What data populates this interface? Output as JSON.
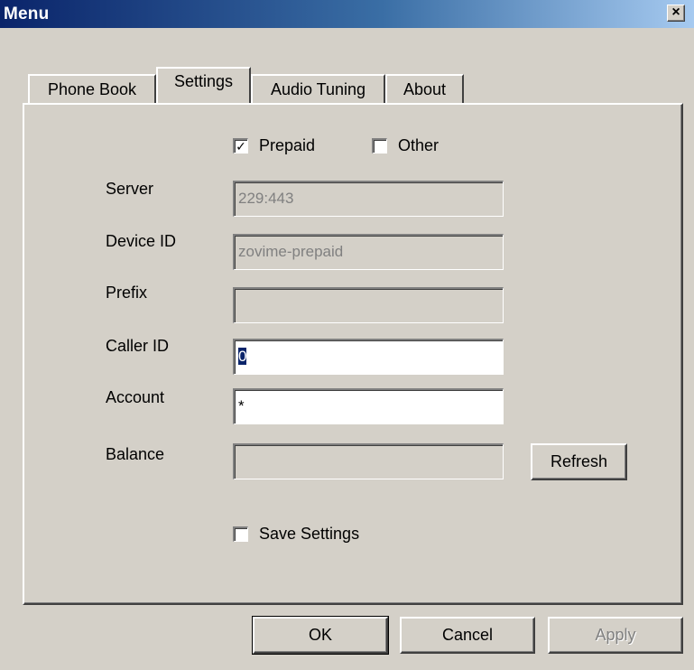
{
  "window": {
    "title": "Menu",
    "close_symbol": "×"
  },
  "tabs": [
    {
      "label": "Phone Book",
      "active": false
    },
    {
      "label": "Settings",
      "active": true
    },
    {
      "label": "Audio Tuning",
      "active": false
    },
    {
      "label": "About",
      "active": false
    }
  ],
  "settings": {
    "prepaid": {
      "label": "Prepaid",
      "checked": true,
      "mark": "✓"
    },
    "other": {
      "label": "Other",
      "checked": false
    },
    "fields": {
      "server": {
        "label": "Server",
        "value": "229:443",
        "enabled": false
      },
      "device_id": {
        "label": "Device ID",
        "value": "zovime-prepaid",
        "enabled": false
      },
      "prefix": {
        "label": "Prefix",
        "value": "",
        "enabled": false
      },
      "caller_id": {
        "label": "Caller ID",
        "value": "0",
        "enabled": true
      },
      "account": {
        "label": "Account",
        "value": "*",
        "enabled": true
      },
      "balance": {
        "label": "Balance",
        "value": "",
        "enabled": false
      }
    },
    "refresh_label": "Refresh",
    "save_settings": {
      "label": "Save Settings",
      "checked": false
    }
  },
  "footer": {
    "ok_label": "OK",
    "cancel_label": "Cancel",
    "apply_label": "Apply"
  },
  "colors": {
    "title_start": "#0a246a",
    "title_end": "#a6caf0",
    "face": "#d4d0c8"
  },
  "icons": {
    "close": "close-icon",
    "check": "checkmark-icon"
  }
}
